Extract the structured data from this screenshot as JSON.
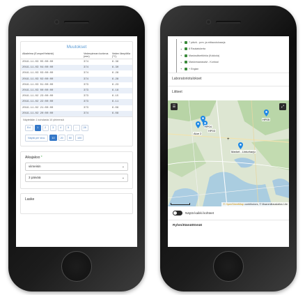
{
  "left": {
    "card_title": "Muutokset",
    "columns": [
      "Aikaleima (Europe/Helsinki)",
      "Vedenpinnan korkeus (mm)",
      "Veden lämpötila (°C)"
    ],
    "rows": [
      [
        "2019-11-03 05:00:00",
        "374",
        "6.36"
      ],
      [
        "2019-11-03 04:00:00",
        "374",
        "6.30"
      ],
      [
        "2019-11-03 03:00:00",
        "374",
        "6.28"
      ],
      [
        "2019-11-03 02:00:00",
        "374",
        "6.28"
      ],
      [
        "2019-11-03 01:00:00",
        "373",
        "6.23"
      ],
      [
        "2019-11-03 00:00:00",
        "373",
        "6.18"
      ],
      [
        "2019-11-02 23:00:00",
        "373",
        "6.15"
      ],
      [
        "2019-11-02 22:00:00",
        "373",
        "6.11"
      ],
      [
        "2019-11-02 21:00:00",
        "373",
        "6.09"
      ],
      [
        "2019-11-02 20:00:00",
        "374",
        "6.08"
      ]
    ],
    "showing": "Näytetään 1 kohdasta 10 yhteensä",
    "pager": [
      "Ed.",
      "1",
      "2",
      "3",
      "4",
      "5",
      "…",
      "28"
    ],
    "per_page_label": "Näytä per sivu:",
    "per_page": [
      "10",
      "20",
      "50",
      "100"
    ],
    "period_title": "Aikajakso",
    "period_star": "*",
    "period_select": "viimeisin",
    "period_length": "3 päivää",
    "calc_title": "Laske"
  },
  "right": {
    "tree": [
      "7 päivä - pvm. ja mittaustulosarja",
      "8 Raukaiskerta",
      "Mastosälvettörkia (Kokkola)",
      "Mastomaarasalvi - Kuntoal",
      "+ Englan"
    ],
    "lab_results": "Laboratoriotulokset",
    "attachments": "Liitteet",
    "map": {
      "pins": [
        "HP04",
        "HP03",
        "HP05",
        "Alue 2",
        "Market - Linturharju"
      ],
      "attribution_osm": "© OpenStreetMap",
      "attribution_rest": "contributors, © Maanmittauslaitos",
      "attribution_lite": "Lite"
    },
    "toggle_label": "Näytä kaikki kohteet",
    "ungrouped": "Ryhmittämättömät"
  }
}
